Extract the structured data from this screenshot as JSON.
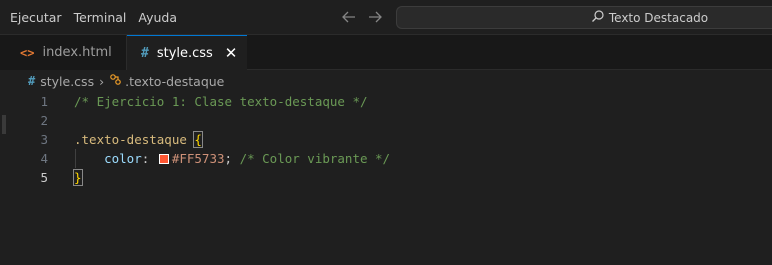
{
  "menu": {
    "items": [
      "Ejecutar",
      "Terminal",
      "Ayuda"
    ]
  },
  "search": {
    "text": "Texto Destacado"
  },
  "tabs": [
    {
      "label": "index.html",
      "icon": "html-file-icon",
      "active": false
    },
    {
      "label": "style.css",
      "icon": "css-file-icon",
      "active": true
    }
  ],
  "breadcrumb": {
    "file": "style.css",
    "symbol": ".texto-destaque"
  },
  "editor": {
    "line_numbers": [
      "1",
      "2",
      "3",
      "4",
      "5"
    ],
    "current_line": "5",
    "comment_line1": "/* Ejercicio 1: Clase texto-destaque */",
    "selector": ".texto-destaque",
    "open_brace": "{",
    "property": "color",
    "colon": ":",
    "value": "#FF5733",
    "semicolon": ";",
    "inline_comment": "/* Color vibrante */",
    "close_brace": "}",
    "swatch_color": "#FF5733"
  },
  "colors": {
    "accent": "#0078d4",
    "background": "#1f1f1f"
  }
}
